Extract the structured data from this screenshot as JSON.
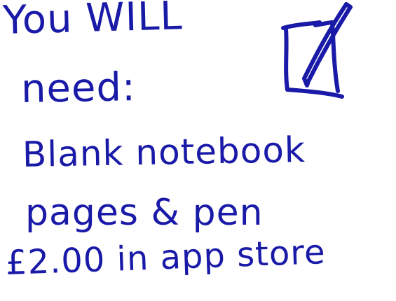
{
  "colors": {
    "ink": "#1a1aa8",
    "background": "#ffffff"
  },
  "icon": "notepad-pen-icon",
  "lines": [
    "You WILL",
    "need:",
    "Blank notebook",
    "pages & pen",
    "£2.00 in app store"
  ]
}
